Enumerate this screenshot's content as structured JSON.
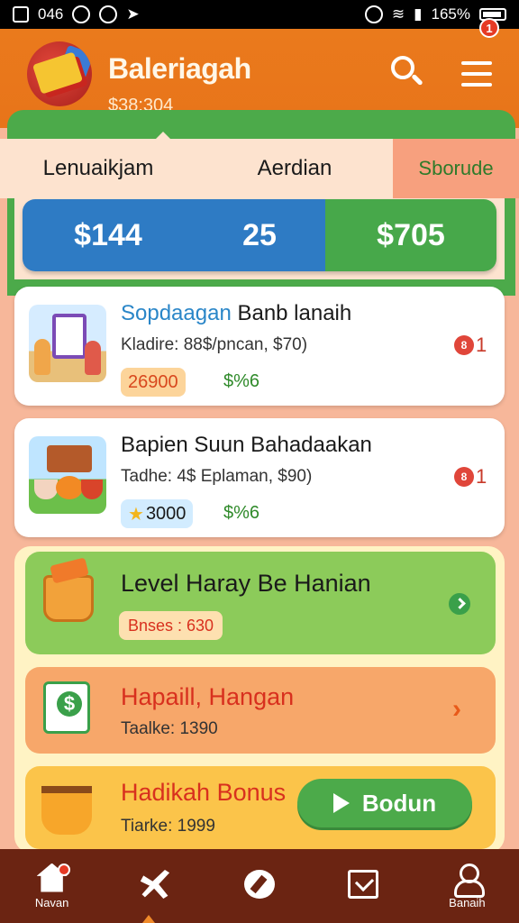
{
  "status_bar": {
    "time": "046",
    "battery": "165%"
  },
  "header": {
    "title": "Baleriagah",
    "subtitle": "$38:304",
    "notification_count": "1"
  },
  "tabs": [
    {
      "label": "Lenuaikjam"
    },
    {
      "label": "Aerdian"
    },
    {
      "label": "Sborude"
    }
  ],
  "stats": [
    {
      "value": "$144"
    },
    {
      "value": "25"
    },
    {
      "value": "$705"
    }
  ],
  "cards": [
    {
      "title_highlight": "Sopdaagan",
      "title_rest": " Banb lanaih",
      "subtitle": "Kladire: 88$/pncan, $70)",
      "pill": "26900",
      "percent": "$%6",
      "badge": "8",
      "count": "1"
    },
    {
      "title": "Bapien Suun Bahadaakan",
      "subtitle": "Tadhe: 4$ Eplaman, $90)",
      "pill": "3000",
      "percent": "$%6",
      "badge": "8",
      "count": "1"
    }
  ],
  "rows": [
    {
      "title": "Level Haray Be Hanian",
      "pill": "Bnses : 630"
    },
    {
      "title": "Hapaill, Hangan",
      "subtitle": "Taalke: 1390"
    },
    {
      "title": "Hadikah Bonus",
      "subtitle": "Tiarke: 1999",
      "button": "Bodun"
    }
  ],
  "bottom_nav": [
    {
      "label": "Navan",
      "icon": "home-icon"
    },
    {
      "label": "",
      "icon": "plane-icon"
    },
    {
      "label": "",
      "icon": "edit-icon"
    },
    {
      "label": "",
      "icon": "mail-icon"
    },
    {
      "label": "Banaih",
      "icon": "user-icon"
    }
  ],
  "colors": {
    "header": "#e8741a",
    "primary_blue": "#2e7bc4",
    "primary_green": "#4caa4a",
    "nav_bg": "#6b2412"
  }
}
